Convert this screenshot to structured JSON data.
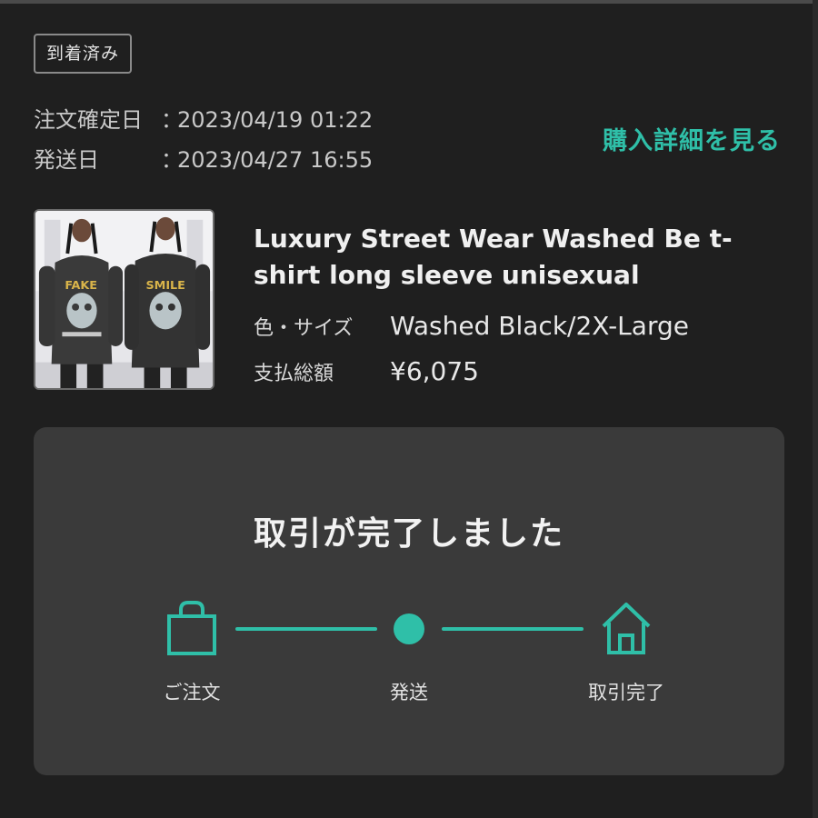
{
  "status_badge": "到着済み",
  "dates": {
    "order_label": "注文確定日",
    "order_value": "2023/04/19 01:22",
    "ship_label": "発送日",
    "ship_value": "2023/04/27 16:55",
    "separator": "："
  },
  "detail_link": "購入詳細を見る",
  "product": {
    "title": "Luxury Street Wear Washed Be t-shirt long sleeve unisexual",
    "color_size_label": "色・サイズ",
    "color_size_value": "Washed Black/2X-Large",
    "total_label": "支払総額",
    "total_value": "¥6,075"
  },
  "progress": {
    "title": "取引が完了しました",
    "steps": [
      {
        "label": "ご注文",
        "icon": "shopping-bag-icon"
      },
      {
        "label": "発送",
        "icon": "dot-icon"
      },
      {
        "label": "取引完了",
        "icon": "house-icon"
      }
    ],
    "completed_steps": 3
  },
  "colors": {
    "background": "#1f1f1f",
    "card": "#3a3a3a",
    "accent": "#2fbfa8"
  }
}
